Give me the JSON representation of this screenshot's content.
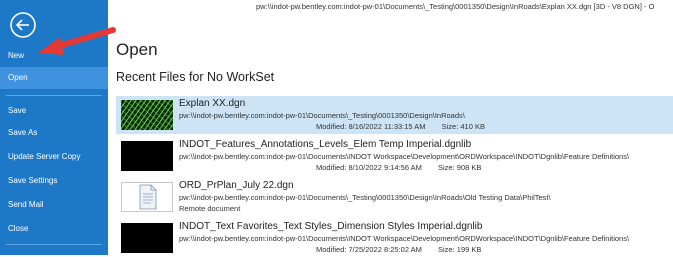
{
  "window": {
    "path": "pw:\\\\indot-pw.bentley.com:indot-pw-01\\Documents\\_Testing\\0001350\\Design\\InRoads\\Explan XX.dgn [3D - V8 DGN] - O"
  },
  "sidebar": {
    "back_icon": "back-arrow-circle-icon",
    "items": [
      {
        "label": "New"
      },
      {
        "label": "Open"
      },
      {
        "label": "Save"
      },
      {
        "label": "Save As"
      },
      {
        "label": "Update Server Copy"
      },
      {
        "label": "Save Settings"
      },
      {
        "label": "Send Mail"
      },
      {
        "label": "Close"
      }
    ],
    "selected": "Open"
  },
  "main": {
    "title": "Open",
    "section": "Recent Files for No WorkSet",
    "files": [
      {
        "name": "Explan XX.dgn",
        "path": "pw:\\\\indot-pw.bentley.com:indot-pw-01\\Documents\\_Testing\\0001350\\Design\\InRoads\\",
        "modified": "Modified: 8/16/2022 11:33:15 AM",
        "size": "Size: 410 KB"
      },
      {
        "name": "INDOT_Features_Annotations_Levels_Elem Temp Imperial.dgnlib",
        "path": "pw:\\\\indot-pw.bentley.com:indot-pw-01\\Documents\\INDOT Workspace\\Development\\ORDWorkspace\\INDOT\\Dgnlib\\Feature Definitions\\",
        "modified": "Modified: 8/10/2022 9:14:56 AM",
        "size": "Size: 908 KB"
      },
      {
        "name": "ORD_PrPlan_July 22.dgn",
        "path": "pw:\\\\indot-pw.bentley.com:indot-pw-01\\Documents\\_Testing\\0001350\\Design\\InRoads\\Old Testing Data\\PhilTest\\",
        "remote": "Remote document"
      },
      {
        "name": "INDOT_Text Favorites_Text Styles_Dimension Styles Imperial.dgnlib",
        "path": "pw:\\\\indot-pw.bentley.com:indot-pw-01\\Documents\\INDOT Workspace\\Development\\ORDWorkspace\\INDOT\\Dgnlib\\Feature Definitions\\",
        "modified": "Modified: 7/25/2022 8:25:02 AM",
        "size": "Size: 199 KB"
      }
    ]
  },
  "colors": {
    "sidebar": "#1e78c8",
    "selected_nav": "#3e92de",
    "selected_row": "#cce4f6",
    "annotation_arrow": "#e53935"
  }
}
